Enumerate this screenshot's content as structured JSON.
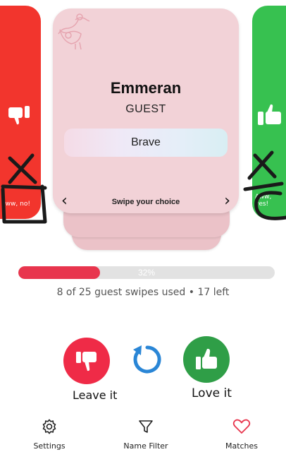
{
  "left_panel": {
    "label": "Eww, no!",
    "color": "#f2352d",
    "icon": "thumbs-down-icon"
  },
  "right_panel": {
    "label": "Aww, yes!",
    "color": "#37c150",
    "icon": "thumbs-up-icon"
  },
  "card": {
    "logo_icon": "stork-icon",
    "name": "Emmeran",
    "role": "GUEST",
    "trait": "Brave",
    "prev_arrow": "‹",
    "next_arrow": "›",
    "hint": "Swipe your choice"
  },
  "progress": {
    "percent_label": "32%",
    "fraction": 0.32,
    "fill_color": "#e8354d"
  },
  "usage_text": "8 of 25 guest swipes used • 17 left",
  "actions": {
    "leave_label": "Leave it",
    "love_label": "Love it",
    "undo_icon": "undo-icon"
  },
  "bottom_nav": {
    "settings": "Settings",
    "name_filter": "Name Filter",
    "matches": "Matches"
  }
}
